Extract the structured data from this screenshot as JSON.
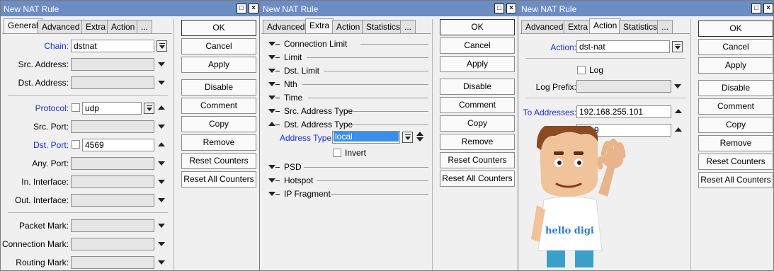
{
  "win1": {
    "title": "New NAT Rule",
    "tabs": [
      "General",
      "Advanced",
      "Extra",
      "Action",
      "..."
    ],
    "labels": {
      "chain": "Chain:",
      "src_address": "Src. Address:",
      "dst_address": "Dst. Address:",
      "protocol": "Protocol:",
      "src_port": "Src. Port:",
      "dst_port": "Dst. Port:",
      "any_port": "Any. Port:",
      "in_interface": "In. Interface:",
      "out_interface": "Out. Interface:",
      "packet_mark": "Packet Mark:",
      "connection_mark": "Connection Mark:",
      "routing_mark": "Routing Mark:"
    },
    "values": {
      "chain": "dstnat",
      "protocol": "udp",
      "dst_port": "4569"
    }
  },
  "win2": {
    "title": "New NAT Rule",
    "tabs": [
      "Advanced",
      "Extra",
      "Action",
      "Statistics",
      "..."
    ],
    "sections": [
      "Connection Limit",
      "Limit",
      "Dst. Limit",
      "Nth",
      "Time",
      "Src. Address Type",
      "Dst. Address Type"
    ],
    "address_type_label": "Address Type:",
    "address_type_value": "local",
    "invert": "Invert",
    "sections2": [
      "PSD",
      "Hotspot",
      "IP Fragment"
    ]
  },
  "win3": {
    "title": "New NAT Rule",
    "tabs": [
      "Advanced",
      "Extra",
      "Action",
      "Statistics",
      "..."
    ],
    "labels": {
      "action": "Action:",
      "log": "Log",
      "log_prefix": "Log Prefix:",
      "to_addresses": "To Addresses:"
    },
    "values": {
      "action": "dst-nat",
      "to_addresses": "192.168.255.101",
      "to_ports_partial": "9"
    },
    "mascot_text": "hello digi"
  },
  "buttons": [
    "OK",
    "Cancel",
    "Apply",
    "Disable",
    "Comment",
    "Copy",
    "Remove",
    "Reset Counters",
    "Reset All Counters"
  ]
}
